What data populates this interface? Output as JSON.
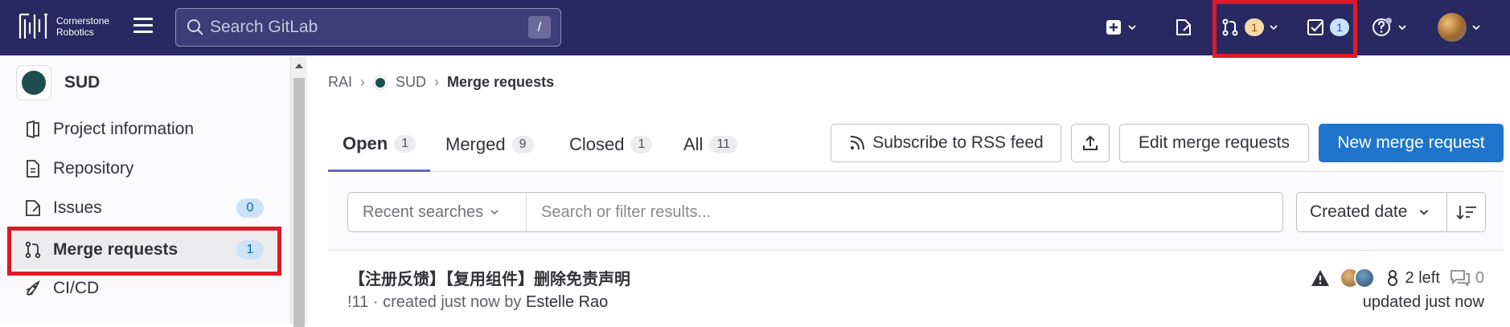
{
  "brand": {
    "line1": "Cornerstone",
    "line2": "Robotics"
  },
  "search": {
    "placeholder": "Search GitLab",
    "shortcut": "/"
  },
  "topbar": {
    "merge_requests_count": "1",
    "todos_count": "1"
  },
  "project": {
    "name": "SUD"
  },
  "sidebar": {
    "items": [
      {
        "label": "Project information",
        "icon": "project-icon"
      },
      {
        "label": "Repository",
        "icon": "document-icon"
      },
      {
        "label": "Issues",
        "icon": "issues-icon",
        "count": "0"
      },
      {
        "label": "Merge requests",
        "icon": "merge-request-icon",
        "count": "1"
      },
      {
        "label": "CI/CD",
        "icon": "rocket-icon"
      }
    ]
  },
  "breadcrumb": {
    "root": "RAI",
    "project": "SUD",
    "current": "Merge requests"
  },
  "tabs": [
    {
      "label": "Open",
      "count": "1"
    },
    {
      "label": "Merged",
      "count": "9"
    },
    {
      "label": "Closed",
      "count": "1"
    },
    {
      "label": "All",
      "count": "11"
    }
  ],
  "actions": {
    "rss": "Subscribe to RSS feed",
    "edit": "Edit merge requests",
    "new": "New merge request"
  },
  "filter": {
    "recent": "Recent searches",
    "placeholder": "Search or filter results...",
    "sort": "Created date"
  },
  "merge_request": {
    "title": "【注册反馈】【复用组件】删除免责声明",
    "ref": "!11",
    "created": " · created just now by ",
    "author": "Estelle Rao",
    "approvals": "2 left",
    "comments": "0",
    "updated": "updated just now"
  },
  "colors": {
    "topbar": "#292961",
    "primary": "#1f75cb",
    "highlight": "#e01929"
  }
}
